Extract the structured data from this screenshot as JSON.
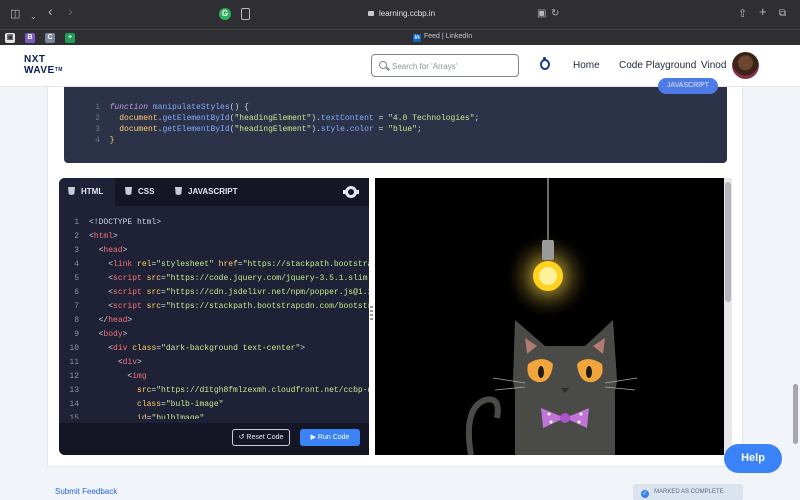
{
  "browser": {
    "sidebar_icon": "sidebar-icon",
    "chevron_icon": "chevron-down-icon",
    "back_icon": "back-arrow-icon",
    "forward_icon": "forward-arrow-icon",
    "extension_letter": "G",
    "url": "learning.ccbp.in",
    "translate_icon": "translate-icon",
    "reload_icon": "reload-icon",
    "share_icon": "share-icon",
    "new_tab_icon": "+",
    "tabs_icon": "tabs-overview-icon"
  },
  "tab_bar": {
    "favicons": [
      {
        "letter": "B",
        "color": "#7a5cc4"
      },
      {
        "letter": "C",
        "color": "#7c8799"
      },
      {
        "letter": "+",
        "color": "#1f9d55"
      }
    ],
    "active_tab_title": "Feed | LinkedIn",
    "active_tab_icon": "in"
  },
  "header": {
    "logo_line1": "NXT",
    "logo_line2": "WAVE",
    "logo_tm": "TM",
    "search_placeholder": "Search for 'Arrays'",
    "nav": [
      "Home",
      "Code Playground",
      "Vinod"
    ]
  },
  "snippet": {
    "language_badge": "JAVASCRIPT",
    "lines": [
      {
        "n": "1",
        "parts": [
          [
            "kw",
            "function"
          ],
          [
            "pl",
            " "
          ],
          [
            "fn",
            "manipulateStyles"
          ],
          [
            "pl",
            "() {"
          ]
        ]
      },
      {
        "n": "2",
        "parts": [
          [
            "pl",
            "  "
          ],
          [
            "obj",
            "document"
          ],
          [
            "pl",
            "."
          ],
          [
            "fn",
            "getElementById"
          ],
          [
            "pl",
            "("
          ],
          [
            "str",
            "\"headingElement\""
          ],
          [
            "pl",
            ")."
          ],
          [
            "fn",
            "textContent"
          ],
          [
            "pl",
            " = "
          ],
          [
            "str",
            "\"4.0 Technologies\""
          ],
          [
            "pl",
            ";"
          ]
        ]
      },
      {
        "n": "3",
        "parts": [
          [
            "pl",
            "  "
          ],
          [
            "obj",
            "document"
          ],
          [
            "pl",
            "."
          ],
          [
            "fn",
            "getElementById"
          ],
          [
            "pl",
            "("
          ],
          [
            "str",
            "\"headingElement\""
          ],
          [
            "pl",
            ")."
          ],
          [
            "fn",
            "style"
          ],
          [
            "pl",
            "."
          ],
          [
            "fn",
            "color"
          ],
          [
            "pl",
            " = "
          ],
          [
            "str",
            "\"blue\""
          ],
          [
            "pl",
            ";"
          ]
        ]
      },
      {
        "n": "4",
        "parts": [
          [
            "obj",
            "}"
          ]
        ]
      }
    ]
  },
  "editor": {
    "tabs": [
      "HTML",
      "CSS",
      "JAVASCRIPT"
    ],
    "active_tab": "HTML",
    "lines": [
      {
        "n": "1",
        "indent": 0,
        "parts": [
          [
            "pl",
            "<!DOCTYPE html>"
          ]
        ]
      },
      {
        "n": "2",
        "indent": 0,
        "parts": [
          [
            "pl",
            "<"
          ],
          [
            "tag",
            "html"
          ],
          [
            "pl",
            ">"
          ]
        ]
      },
      {
        "n": "3",
        "indent": 1,
        "parts": [
          [
            "pl",
            "<"
          ],
          [
            "tag",
            "head"
          ],
          [
            "pl",
            ">"
          ]
        ]
      },
      {
        "n": "4",
        "indent": 2,
        "parts": [
          [
            "pl",
            "<"
          ],
          [
            "tag",
            "link"
          ],
          [
            "pl",
            " "
          ],
          [
            "attr",
            "rel"
          ],
          [
            "pl",
            "="
          ],
          [
            "val",
            "\"stylesheet\""
          ],
          [
            "pl",
            " "
          ],
          [
            "attr",
            "href"
          ],
          [
            "pl",
            "="
          ],
          [
            "val",
            "\"https://stackpath.bootstra"
          ]
        ]
      },
      {
        "n": "5",
        "indent": 2,
        "parts": [
          [
            "pl",
            "<"
          ],
          [
            "tag",
            "script"
          ],
          [
            "pl",
            " "
          ],
          [
            "attr",
            "src"
          ],
          [
            "pl",
            "="
          ],
          [
            "val",
            "\"https://code.jquery.com/jquery-3.5.1.slim"
          ]
        ]
      },
      {
        "n": "6",
        "indent": 2,
        "parts": [
          [
            "pl",
            "<"
          ],
          [
            "tag",
            "script"
          ],
          [
            "pl",
            " "
          ],
          [
            "attr",
            "src"
          ],
          [
            "pl",
            "="
          ],
          [
            "val",
            "\"https://cdn.jsdelivr.net/npm/popper.js@1.1"
          ]
        ]
      },
      {
        "n": "7",
        "indent": 2,
        "parts": [
          [
            "pl",
            "<"
          ],
          [
            "tag",
            "script"
          ],
          [
            "pl",
            " "
          ],
          [
            "attr",
            "src"
          ],
          [
            "pl",
            "="
          ],
          [
            "val",
            "\"https://stackpath.bootstrapcdn.com/bootstr"
          ]
        ]
      },
      {
        "n": "8",
        "indent": 1,
        "parts": [
          [
            "pl",
            "</"
          ],
          [
            "tag",
            "head"
          ],
          [
            "pl",
            ">"
          ]
        ]
      },
      {
        "n": "9",
        "indent": 1,
        "parts": [
          [
            "pl",
            "<"
          ],
          [
            "tag",
            "body"
          ],
          [
            "pl",
            ">"
          ]
        ]
      },
      {
        "n": "10",
        "indent": 2,
        "parts": [
          [
            "pl",
            "<"
          ],
          [
            "tag",
            "div"
          ],
          [
            "pl",
            " "
          ],
          [
            "attr",
            "class"
          ],
          [
            "pl",
            "="
          ],
          [
            "val",
            "\"dark-background text-center\""
          ],
          [
            "pl",
            ">"
          ]
        ]
      },
      {
        "n": "11",
        "indent": 3,
        "parts": [
          [
            "pl",
            "<"
          ],
          [
            "tag",
            "div"
          ],
          [
            "pl",
            ">"
          ]
        ]
      },
      {
        "n": "12",
        "indent": 4,
        "parts": [
          [
            "pl",
            "<"
          ],
          [
            "tag",
            "img"
          ]
        ]
      },
      {
        "n": "13",
        "indent": 5,
        "parts": [
          [
            "attr",
            "src"
          ],
          [
            "pl",
            "="
          ],
          [
            "val",
            "\"https://d1tgh8fmlzexmh.cloudfront.net/ccbp-d"
          ]
        ]
      },
      {
        "n": "14",
        "indent": 5,
        "parts": [
          [
            "attr",
            "class"
          ],
          [
            "pl",
            "="
          ],
          [
            "val",
            "\"bulb-image\""
          ]
        ]
      },
      {
        "n": "15",
        "indent": 5,
        "parts": [
          [
            "attr",
            "id"
          ],
          [
            "pl",
            "="
          ],
          [
            "val",
            "\"bulbImage\""
          ]
        ]
      }
    ],
    "reset_label": "Reset Code",
    "run_label": "Run Code"
  },
  "output": {
    "description_icons": [
      "light-bulb-icon",
      "cat-illustration"
    ]
  },
  "footer": {
    "submit_feedback": "Submit Feedback",
    "marked_complete": "MARKED AS COMPLETE",
    "help": "Help"
  }
}
